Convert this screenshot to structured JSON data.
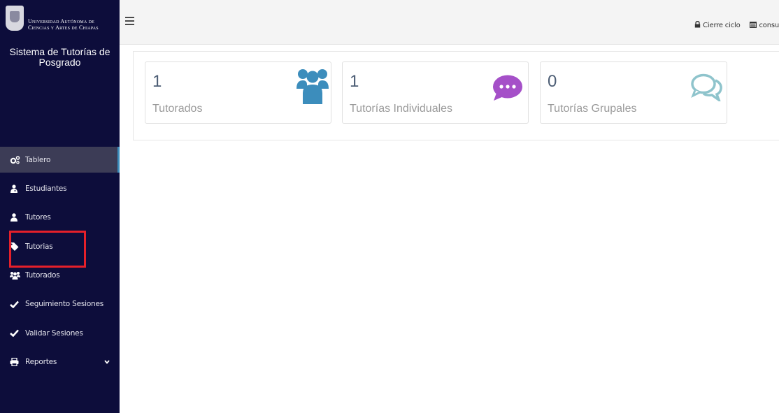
{
  "brand": {
    "university_line1": "Universidad Autónoma de",
    "university_line2": "Ciencias y Artes de Chiapas",
    "system_title": "Sistema de Tutorías de Posgrado"
  },
  "sidebar": {
    "items": [
      {
        "label": "Tablero",
        "icon": "cogs-icon"
      },
      {
        "label": "Estudiantes",
        "icon": "user-md-icon"
      },
      {
        "label": "Tutores",
        "icon": "user-icon"
      },
      {
        "label": "Tutorias",
        "icon": "tag-icon"
      },
      {
        "label": "Tutorados",
        "icon": "users-icon"
      },
      {
        "label": "Seguimiento Sesiones",
        "icon": "check-icon"
      },
      {
        "label": "Validar Sesiones",
        "icon": "check-icon"
      },
      {
        "label": "Reportes",
        "icon": "print-icon"
      }
    ],
    "active_item": "Tablero",
    "highlighted_item": "Tutorias"
  },
  "topbar": {
    "cierre_label": "Cierre ciclo",
    "consulta_label": "consu"
  },
  "cards": [
    {
      "value": "1",
      "label": "Tutorados",
      "icon": "users-icon",
      "color": "#3c8dbc"
    },
    {
      "value": "1",
      "label": "Tutorías Individuales",
      "icon": "comment-dots-icon",
      "color": "#a550c8"
    },
    {
      "value": "0",
      "label": "Tutorías Grupales",
      "icon": "comments-outline-icon",
      "color": "#8fc4cc"
    }
  ],
  "colors": {
    "sidebar_bg": "#0d0d3b",
    "accent": "#3c8dbc",
    "highlight": "#e5202a"
  }
}
